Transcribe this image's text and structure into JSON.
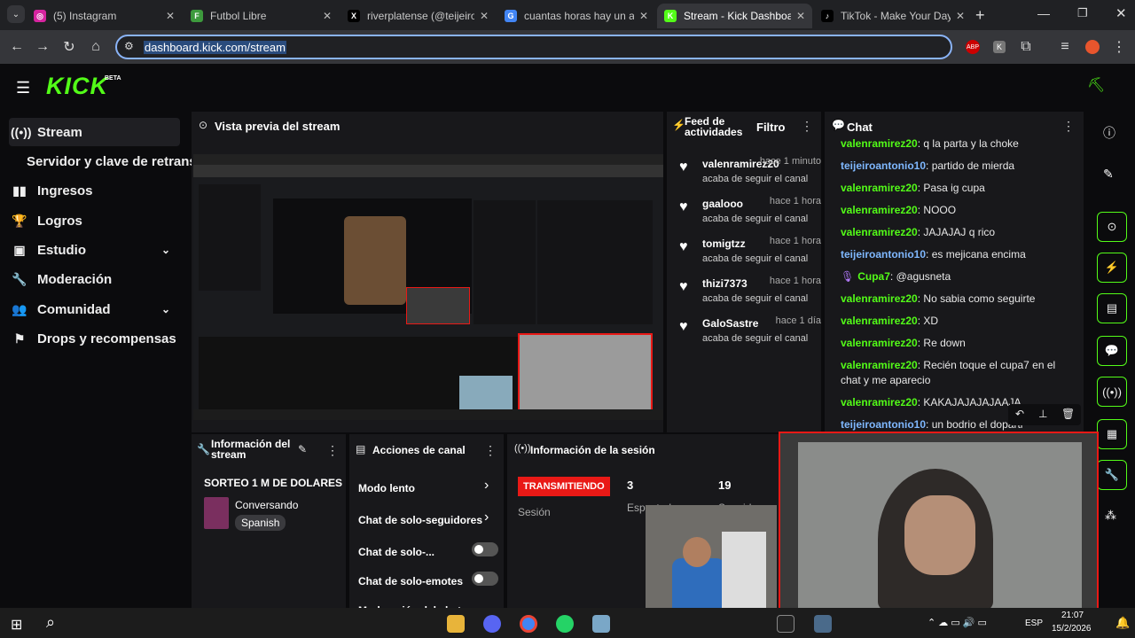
{
  "tabs": [
    {
      "title": "(5) Instagram",
      "color": "#d6249f",
      "glyph": "◎"
    },
    {
      "title": "Futbol Libre",
      "color": "#3d9a3d",
      "glyph": "F"
    },
    {
      "title": "riverplatense (@teijeiroant",
      "color": "#000000",
      "glyph": "X"
    },
    {
      "title": "cuantas horas hay un año",
      "color": "#4285f4",
      "glyph": "G"
    },
    {
      "title": "Stream - Kick Dashboard",
      "color": "#53fc18",
      "glyph": "K"
    },
    {
      "title": "TikTok - Make Your Day",
      "color": "#000000",
      "glyph": "♪"
    }
  ],
  "browser": {
    "url": "dashboard.kick.com/stream",
    "new_tab": "+"
  },
  "kick": {
    "logo": "KICK",
    "beta": "BETA"
  },
  "sidebar": {
    "items": [
      {
        "label": "Stream",
        "icon": "broadcast-icon",
        "glyph": "((•))"
      },
      {
        "label": "Servidor y clave de retransm",
        "icon": "",
        "glyph": ""
      },
      {
        "label": "Ingresos",
        "icon": "bar-chart-icon",
        "glyph": "▮▮"
      },
      {
        "label": "Logros",
        "icon": "trophy-icon",
        "glyph": "🏆"
      },
      {
        "label": "Estudio",
        "icon": "studio-icon",
        "glyph": "▣"
      },
      {
        "label": "Moderación",
        "icon": "wrench-icon",
        "glyph": "🔧"
      },
      {
        "label": "Comunidad",
        "icon": "people-icon",
        "glyph": "👥"
      },
      {
        "label": "Drops y recompensas",
        "icon": "drops-icon",
        "glyph": "⚑"
      }
    ]
  },
  "preview": {
    "title": "Vista previa del stream"
  },
  "feed": {
    "title": "Feed de actividades",
    "filter": "Filtro",
    "items": [
      {
        "name": "valenramirez20",
        "time": "hace 1 minuto",
        "action": "acaba de seguir el canal"
      },
      {
        "name": "gaalooo",
        "time": "hace 1 hora",
        "action": "acaba de seguir el canal"
      },
      {
        "name": "tomigtzz",
        "time": "hace 1 hora",
        "action": "acaba de seguir el canal"
      },
      {
        "name": "thizi7373",
        "time": "hace 1 hora",
        "action": "acaba de seguir el canal"
      },
      {
        "name": "GaloSastre",
        "time": "hace 1 día",
        "action": "acaba de seguir el canal"
      }
    ]
  },
  "chat": {
    "title": "Chat",
    "messages": [
      {
        "user": "valenramirez20",
        "text": "q la parta y la choke",
        "color": "#53fc18"
      },
      {
        "user": "teijeiroantonio10",
        "text": "partido de mierda",
        "color": "#7fb8ff"
      },
      {
        "user": "valenramirez20",
        "text": "Pasa ig cupa",
        "color": "#53fc18"
      },
      {
        "user": "valenramirez20",
        "text": "NOOO",
        "color": "#53fc18"
      },
      {
        "user": "valenramirez20",
        "text": "JAJAJAJ q rico",
        "color": "#53fc18"
      },
      {
        "user": "teijeiroantonio10",
        "text": "es mejicana encima",
        "color": "#7fb8ff"
      },
      {
        "user": "Cupa7",
        "text": "@agusneta",
        "color": "#53fc18"
      },
      {
        "user": "valenramirez20",
        "text": "No sabia como seguirte",
        "color": "#53fc18"
      },
      {
        "user": "valenramirez20",
        "text": "XD",
        "color": "#53fc18"
      },
      {
        "user": "valenramirez20",
        "text": "Re down",
        "color": "#53fc18"
      },
      {
        "user": "valenramirez20",
        "text": "Recién toque el cupa7 en el chat y me aparecio",
        "color": "#53fc18"
      },
      {
        "user": "valenramirez20",
        "text": "KAKAJAJAJAJAAJA",
        "color": "#53fc18"
      },
      {
        "user": "teijeiroantonio10",
        "text": "un bodrio el doparti",
        "color": "#7fb8ff"
      }
    ]
  },
  "stream_info": {
    "title": "Información del stream",
    "stream_title": "SORTEO 1 M DE DOLARES",
    "category": "Conversando",
    "language": "Spanish"
  },
  "channel_actions": {
    "title": "Acciones de canal",
    "items": [
      {
        "label": "Modo lento",
        "type": "arrow"
      },
      {
        "label": "Chat de solo-seguidores",
        "type": "arrow"
      },
      {
        "label": "Chat de solo-...",
        "type": "toggle"
      },
      {
        "label": "Chat de solo-emotes",
        "type": "toggle"
      },
      {
        "label": "Moderación del chat",
        "type": "none"
      }
    ]
  },
  "session": {
    "title": "Información de la sesión",
    "status": "TRANSMITIENDO",
    "status_label": "Sesión",
    "viewers": "3",
    "viewers_label": "Espectadores",
    "followers": "19",
    "followers_label": "Seguidores"
  },
  "taskbar": {
    "lang": "ESP",
    "time": "21:07",
    "date": "15/2/2026"
  },
  "colors": {
    "kick_green": "#53fc18",
    "live_red": "#e91916"
  }
}
